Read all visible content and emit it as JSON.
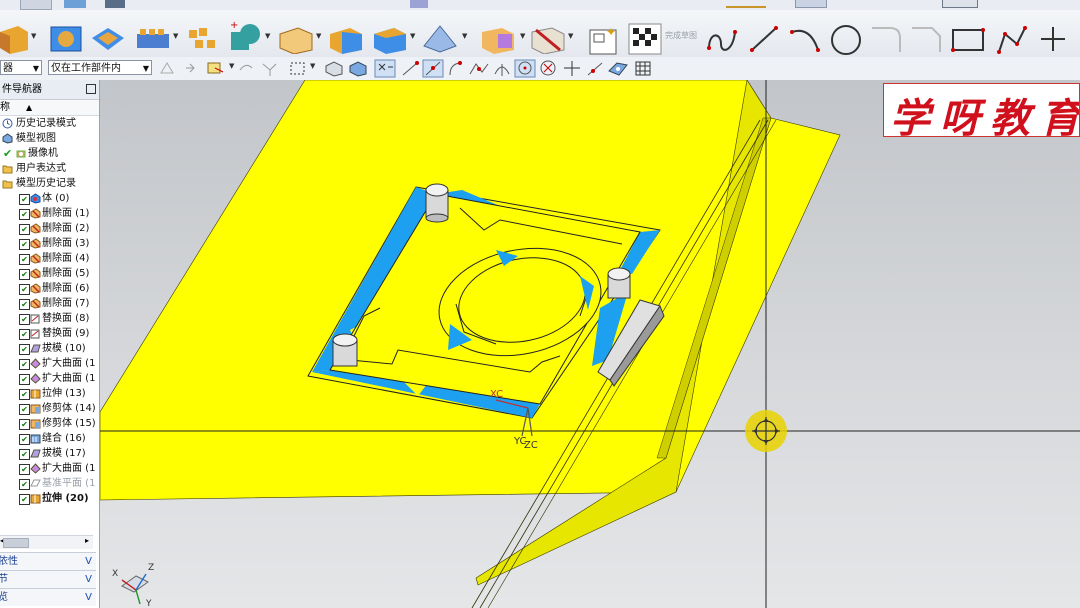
{
  "toolbar": {
    "filter_select": {
      "value": "器"
    },
    "scope_select": {
      "value": "仅在工作部件内"
    },
    "sketch_finish_label": "完成草图"
  },
  "navigator": {
    "title": "件导航器",
    "column_header": "称",
    "top_nodes": [
      {
        "label": "历史记录模式",
        "icon": "clock-icon"
      },
      {
        "label": "模型视图",
        "icon": "view-icon"
      },
      {
        "label": "摄像机",
        "icon": "camera-icon",
        "checked": true
      },
      {
        "label": "用户表达式",
        "icon": "folder-icon"
      },
      {
        "label": "模型历史记录",
        "icon": "folder-icon"
      }
    ],
    "features": [
      {
        "label": "体 (0)",
        "icon": "body-icon"
      },
      {
        "label": "删除面 (1)",
        "icon": "delete-face-icon"
      },
      {
        "label": "删除面 (2)",
        "icon": "delete-face-icon"
      },
      {
        "label": "删除面 (3)",
        "icon": "delete-face-icon"
      },
      {
        "label": "删除面 (4)",
        "icon": "delete-face-icon"
      },
      {
        "label": "删除面 (5)",
        "icon": "delete-face-icon"
      },
      {
        "label": "删除面 (6)",
        "icon": "delete-face-icon"
      },
      {
        "label": "删除面 (7)",
        "icon": "delete-face-icon"
      },
      {
        "label": "替换面 (8)",
        "icon": "replace-face-icon"
      },
      {
        "label": "替换面 (9)",
        "icon": "replace-face-icon"
      },
      {
        "label": "拔模 (10)",
        "icon": "draft-icon"
      },
      {
        "label": "扩大曲面 (1",
        "icon": "enlarge-icon"
      },
      {
        "label": "扩大曲面 (1",
        "icon": "enlarge-icon"
      },
      {
        "label": "拉伸 (13)",
        "icon": "extrude-icon"
      },
      {
        "label": "修剪体 (14)",
        "icon": "trim-icon"
      },
      {
        "label": "修剪体 (15)",
        "icon": "trim-icon"
      },
      {
        "label": "缝合 (16)",
        "icon": "sew-icon"
      },
      {
        "label": "拔模 (17)",
        "icon": "draft-icon"
      },
      {
        "label": "扩大曲面 (1",
        "icon": "enlarge-icon"
      },
      {
        "label": "基准平面 (1",
        "icon": "datum-plane-icon",
        "muted": true
      },
      {
        "label": "拉伸 (20)",
        "icon": "extrude-icon",
        "bold": true
      }
    ]
  },
  "panels": [
    {
      "label": "相依性"
    },
    {
      "label": "细节"
    },
    {
      "label": "预览"
    }
  ],
  "viewport": {
    "csys_label_x": "XC",
    "csys_label_y": "YC",
    "csys_label_z": "ZC",
    "triad_x": "X",
    "triad_y": "Y",
    "triad_z": "Z"
  },
  "logo": {
    "text": "学呀教育"
  },
  "colors": {
    "part_face": "#ffff00",
    "draft_face": "#1ea0f0",
    "viewport_bg": "#d2d4d7",
    "logo_red": "#d0101c"
  }
}
